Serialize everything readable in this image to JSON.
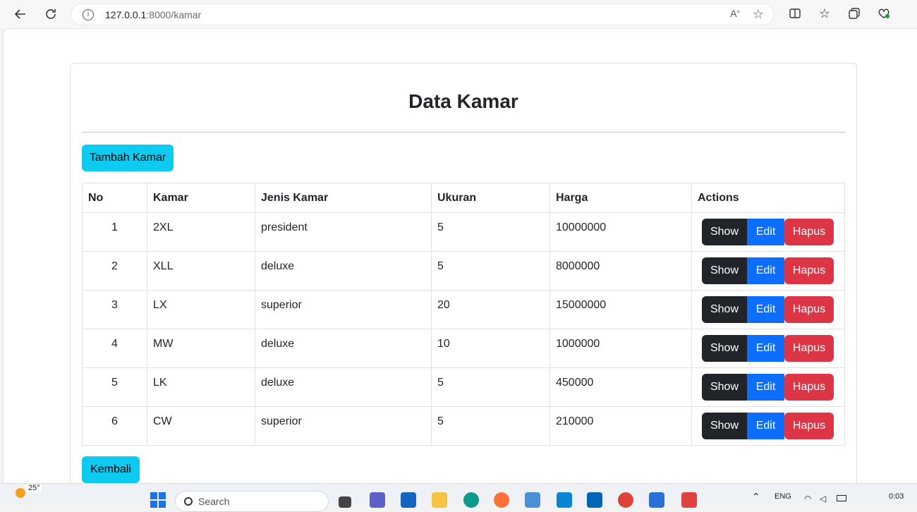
{
  "browser": {
    "url_host": "127.0.0.1",
    "url_path": ":8000/kamar"
  },
  "page": {
    "title": "Data Kamar",
    "add_button": "Tambah Kamar",
    "back_button": "Kembali"
  },
  "table": {
    "headers": [
      "No",
      "Kamar",
      "Jenis Kamar",
      "Ukuran",
      "Harga",
      "Actions"
    ],
    "rows": [
      {
        "no": "1",
        "kamar": "2XL",
        "jenis": "president",
        "ukuran": "5",
        "harga": "10000000"
      },
      {
        "no": "2",
        "kamar": "XLL",
        "jenis": "deluxe",
        "ukuran": "5",
        "harga": "8000000"
      },
      {
        "no": "3",
        "kamar": "LX",
        "jenis": "superior",
        "ukuran": "20",
        "harga": "15000000"
      },
      {
        "no": "4",
        "kamar": "MW",
        "jenis": "deluxe",
        "ukuran": "10",
        "harga": "1000000"
      },
      {
        "no": "5",
        "kamar": "LK",
        "jenis": "deluxe",
        "ukuran": "5",
        "harga": "450000"
      },
      {
        "no": "6",
        "kamar": "CW",
        "jenis": "superior",
        "ukuran": "5",
        "harga": "210000"
      }
    ],
    "actions": {
      "show": "Show",
      "edit": "Edit",
      "delete": "Hapus"
    }
  },
  "taskbar": {
    "weather": "25°",
    "search_placeholder": "Search",
    "language": "ENG",
    "time": "0:03"
  },
  "colors": {
    "info": "#0dcaf0",
    "dark": "#212529",
    "primary": "#0d6efd",
    "danger": "#dc3545"
  }
}
